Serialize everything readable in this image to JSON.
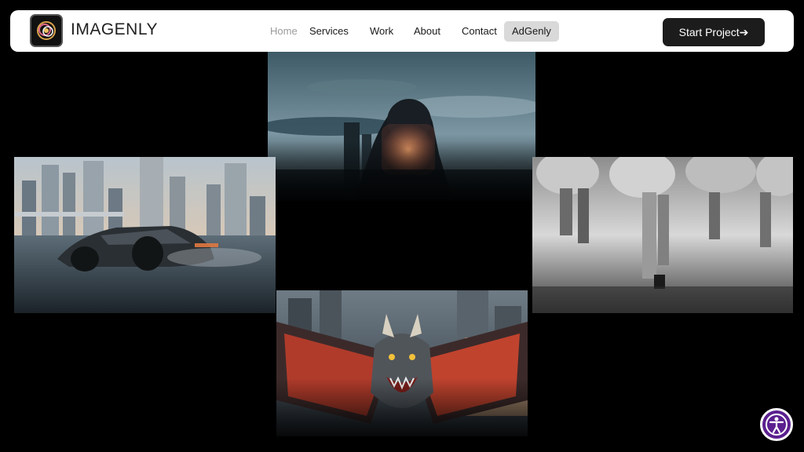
{
  "brand": {
    "name": "IMAGENLY",
    "logo_icon": "imagenly-logo-icon"
  },
  "nav": {
    "items": [
      {
        "label": "Home",
        "state": "muted"
      },
      {
        "label": "Services",
        "state": "normal"
      },
      {
        "label": "Work",
        "state": "normal"
      },
      {
        "label": "About",
        "state": "normal"
      },
      {
        "label": "Contact",
        "state": "normal"
      },
      {
        "label": "AdGenly",
        "state": "highlighted"
      }
    ],
    "cta_label": "Start Project➔"
  },
  "gallery": {
    "images": [
      {
        "subject": "hooded figure in front of a city skyline"
      },
      {
        "subject": "futuristic car on a city road"
      },
      {
        "subject": "people walking in puffer jackets"
      },
      {
        "subject": "dragon in a city"
      }
    ]
  },
  "accessibility": {
    "icon": "accessibility-icon"
  },
  "colors": {
    "navbar_bg": "#ffffff",
    "page_bg": "#000000",
    "cta_bg": "#1c1c1c",
    "pill_bg": "#d9d9d9",
    "a11y_bg": "#5b1f8f"
  }
}
